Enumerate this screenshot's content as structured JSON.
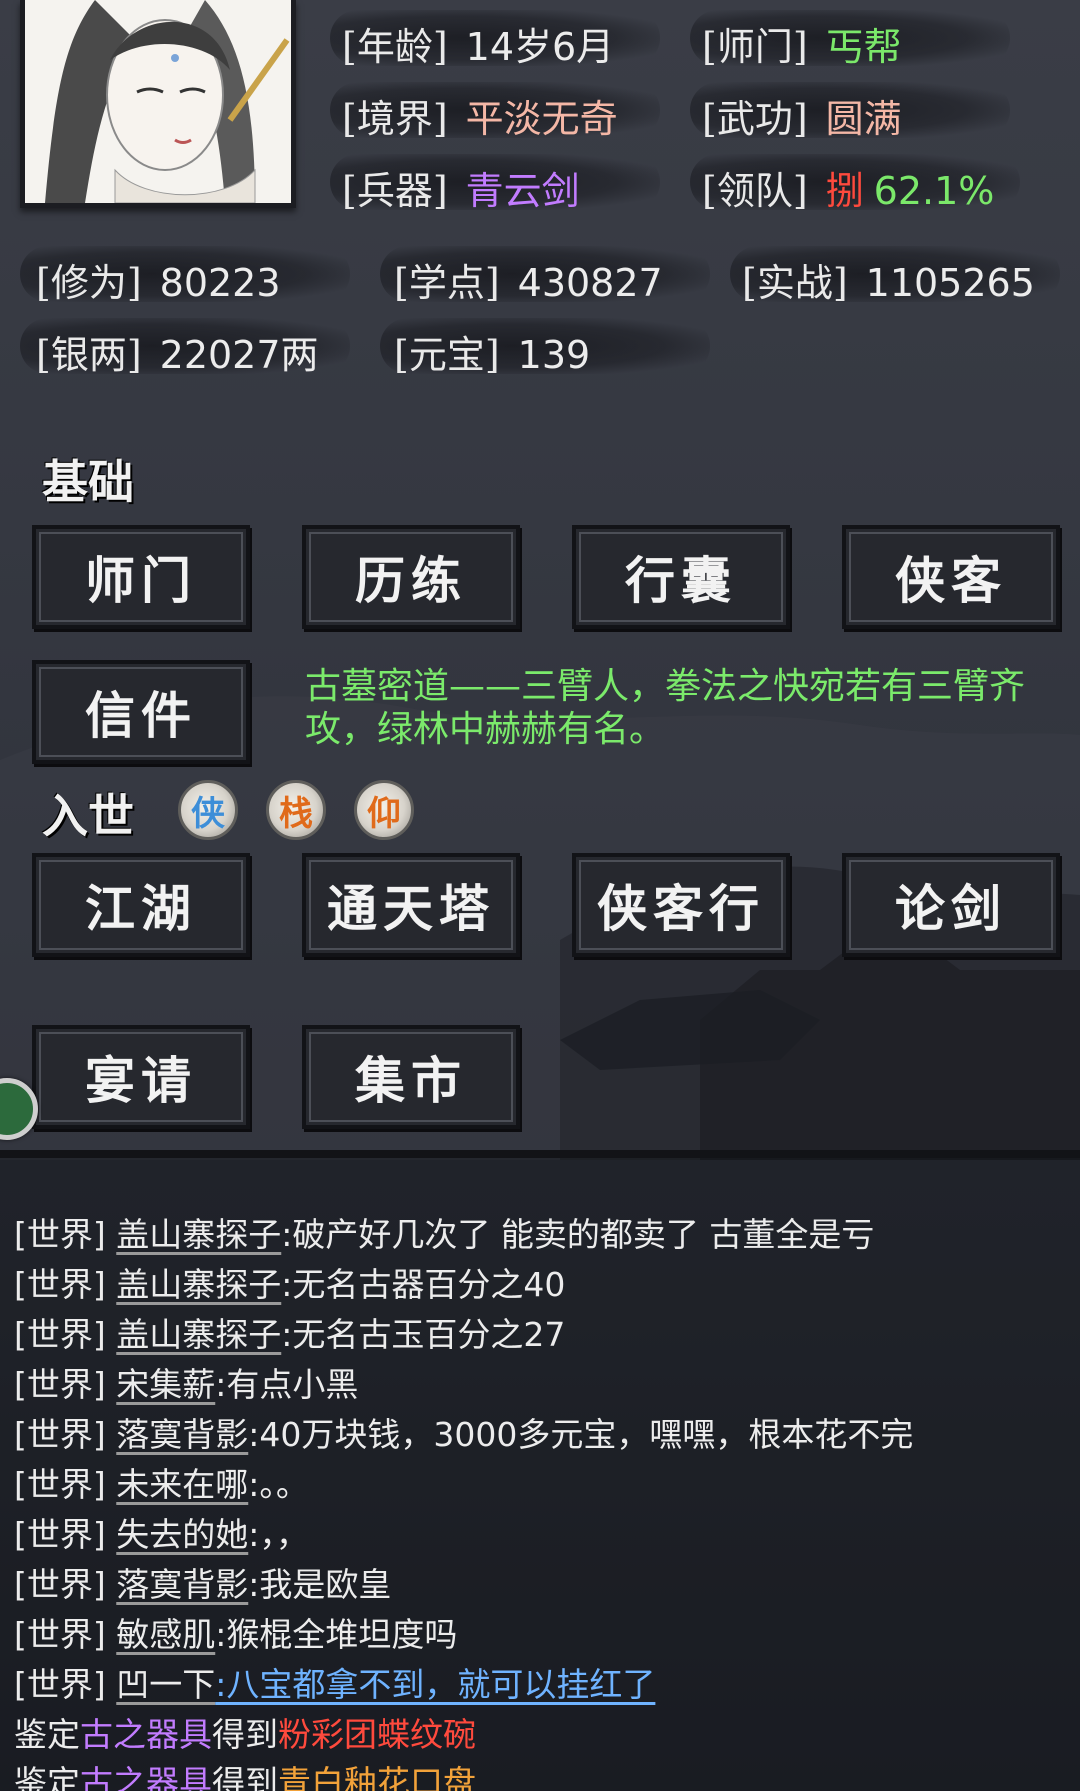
{
  "profile": {
    "age_label": "[年龄]",
    "age_value": "14岁6月",
    "sect_label": "[师门]",
    "sect_value": "丐帮",
    "realm_label": "[境界]",
    "realm_value": "平淡无奇",
    "martial_label": "[武功]",
    "martial_value": "圆满",
    "weapon_label": "[兵器]",
    "weapon_value": "青云剑",
    "leader_label": "[领队]",
    "leader_icon_text": "捌",
    "leader_value": "62.1%"
  },
  "stats": {
    "cultivation_label": "[修为]",
    "cultivation_value": "80223",
    "study_label": "[学点]",
    "study_value": "430827",
    "combat_label": "[实战]",
    "combat_value": "1105265",
    "silver_label": "[银两]",
    "silver_value": "22027两",
    "ingot_label": "[元宝]",
    "ingot_value": "139"
  },
  "basic": {
    "title": "基础",
    "buttons": [
      "师门",
      "历练",
      "行囊",
      "侠客",
      "信件"
    ],
    "quest_text": "古墓密道——三臂人，拳法之快宛若有三臂齐攻，绿林中赫赫有名。"
  },
  "world": {
    "title": "入世",
    "badges": [
      "侠",
      "栈",
      "仰"
    ],
    "buttons": [
      "江湖",
      "通天塔",
      "侠客行",
      "论剑",
      "宴请",
      "集市"
    ]
  },
  "colors": {
    "sect": "#7be86a",
    "realm": "#f4b7a6",
    "martial": "#f4b7a6",
    "weapon": "#c27cff",
    "leader_icon": "#ff4a3d",
    "leader_value": "#7be86a",
    "quest": "#7bea6b",
    "badge_blue": "#3d8ed8",
    "badge_orange": "#e06a1a"
  },
  "chat": {
    "channel": "[世界]",
    "messages": [
      {
        "name": "盖山寨探子",
        "text": ":破产好几次了 能卖的都卖了 古董全是亏"
      },
      {
        "name": "盖山寨探子",
        "text": ":无名古器百分之40"
      },
      {
        "name": "盖山寨探子",
        "text": ":无名古玉百分之27"
      },
      {
        "name": "宋集薪",
        "text": ":有点小黑"
      },
      {
        "name": "落寞背影",
        "text": ":40万块钱，3000多元宝，嘿嘿，根本花不完"
      },
      {
        "name": "未来在哪",
        "text": ":。。"
      },
      {
        "name": "失去的她",
        "text": ":，，"
      },
      {
        "name": "落寞背影",
        "text": ":我是欧皇"
      },
      {
        "name": "敏感肌",
        "text": ":猴棍全堆坦度吗"
      },
      {
        "name": "凹一下",
        "text": ":八宝都拿不到，就可以挂红了"
      }
    ],
    "appraisals": [
      {
        "prefix": "鉴定",
        "item": "古之器具",
        "mid": "得到",
        "result": "粉彩团蝶纹碗"
      },
      {
        "prefix": "鉴定",
        "item": "古之器具",
        "mid": "得到",
        "result": "青白釉花口盘"
      }
    ]
  }
}
